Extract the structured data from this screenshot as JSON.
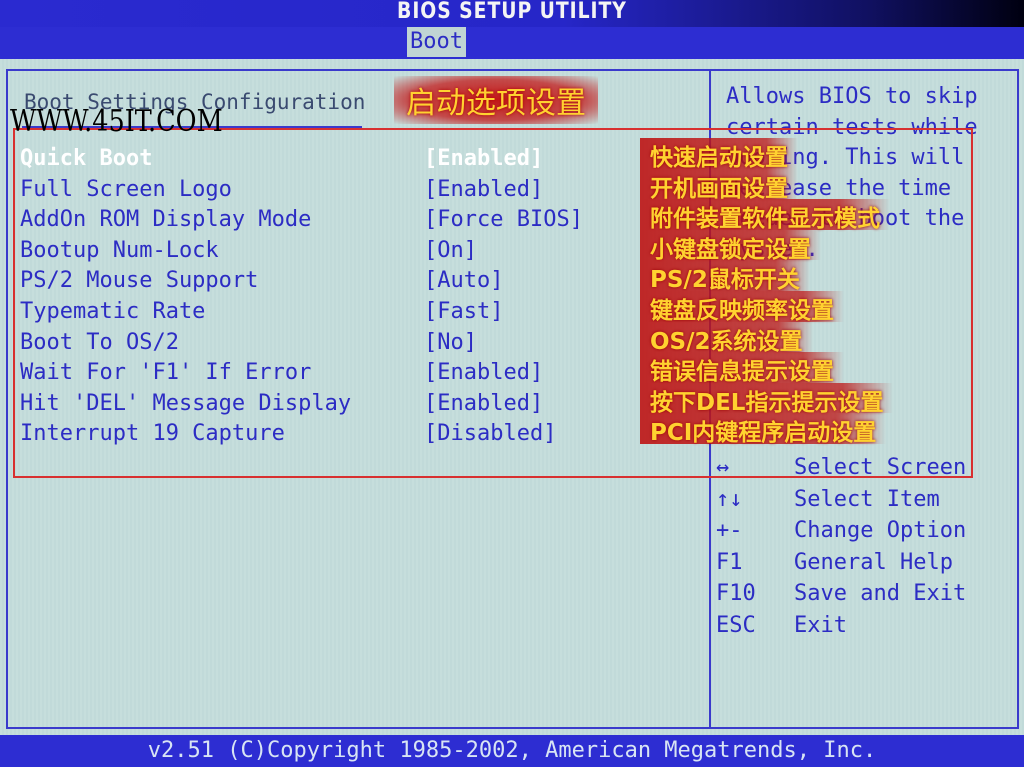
{
  "header": {
    "title": "BIOS SETUP UTILITY"
  },
  "menu": {
    "active_tab": "Boot"
  },
  "watermark": "WWW.45IT.COM",
  "section": {
    "title": "Boot Settings Configuration",
    "cn_heading": "启动选项设置"
  },
  "settings": [
    {
      "label": "Quick Boot",
      "value": "[Enabled]",
      "selected": true,
      "cn": "快速启动设置"
    },
    {
      "label": "Full Screen Logo",
      "value": "[Enabled]",
      "cn": "开机画面设置"
    },
    {
      "label": "AddOn ROM Display Mode",
      "value": "[Force BIOS]",
      "cn": "附件装置软件显示模式"
    },
    {
      "label": "Bootup Num-Lock",
      "value": "[On]",
      "cn": "小键盘锁定设置"
    },
    {
      "label": "PS/2 Mouse Support",
      "value": "[Auto]",
      "cn": "PS/2鼠标开关"
    },
    {
      "label": "Typematic Rate",
      "value": "[Fast]",
      "cn": "键盘反映频率设置"
    },
    {
      "label": "Boot To OS/2",
      "value": "[No]",
      "cn": "OS/2系统设置"
    },
    {
      "label": "Wait For 'F1' If Error",
      "value": "[Enabled]",
      "cn": "错误信息提示设置"
    },
    {
      "label": "Hit 'DEL' Message Display",
      "value": "[Enabled]",
      "cn": "按下DEL指示提示设置"
    },
    {
      "label": "Interrupt 19 Capture",
      "value": "[Disabled]",
      "cn": "PCI内键程序启动设置"
    }
  ],
  "help": {
    "text": "Allows BIOS to skip\ncertain tests while\nbooting. This will\ndecrease the time\nneeded to boot the\nsystem."
  },
  "keys": [
    {
      "key": "↔",
      "desc": "Select Screen"
    },
    {
      "key": "↑↓",
      "desc": "Select Item"
    },
    {
      "key": "+-",
      "desc": "Change Option"
    },
    {
      "key": "F1",
      "desc": "General Help"
    },
    {
      "key": "F10",
      "desc": "Save and Exit"
    },
    {
      "key": "ESC",
      "desc": "Exit"
    }
  ],
  "footer": {
    "text": "v2.51 (C)Copyright 1985-2002, American Megatrends, Inc."
  },
  "colors": {
    "bios_blue": "#2d2dd2",
    "text_blue": "#2c2cc4",
    "panel_bg": "#c6dedc",
    "annotation_red": "#d83030",
    "annotation_yellow": "#ffd230"
  }
}
